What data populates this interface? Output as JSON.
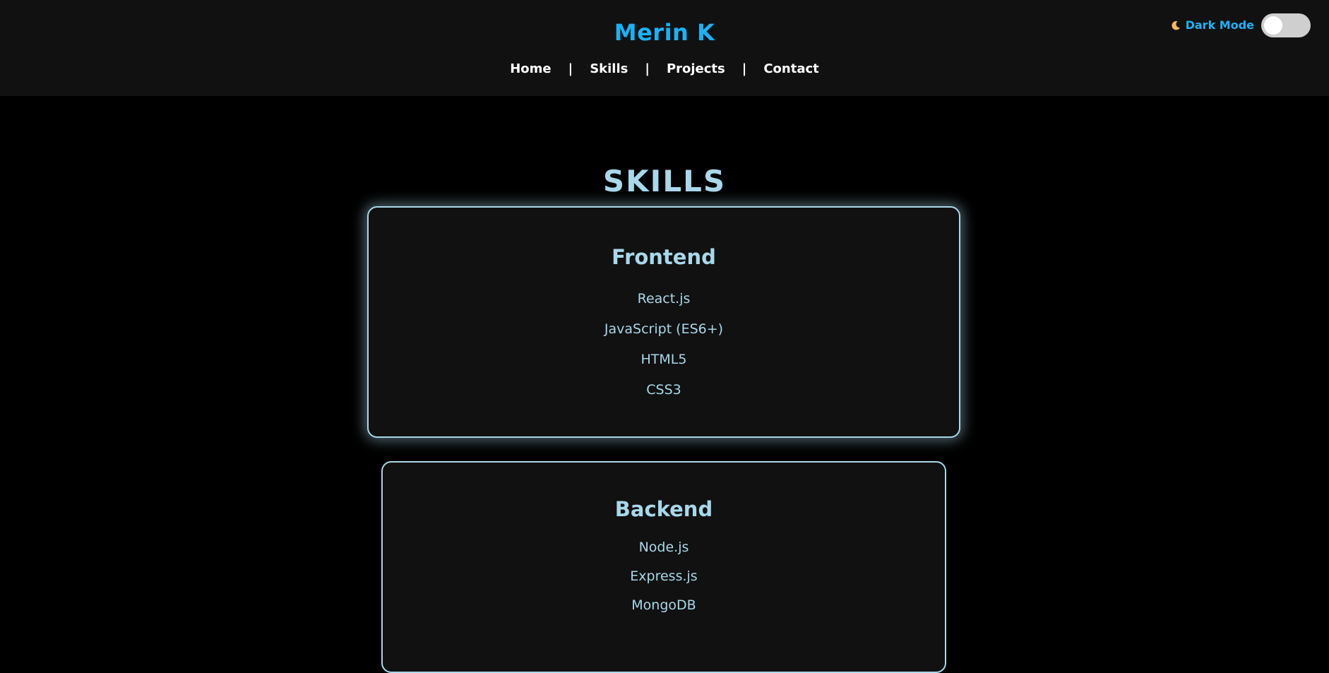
{
  "header": {
    "brand": "Merin K",
    "nav": [
      {
        "label": "Home"
      },
      {
        "label": "Skills"
      },
      {
        "label": "Projects"
      },
      {
        "label": "Contact"
      }
    ],
    "separator": "|",
    "theme_toggle": {
      "icon": "moon-icon",
      "label": "Dark Mode",
      "checked": false
    }
  },
  "main": {
    "title": "SKILLS",
    "cards": [
      {
        "title": "Frontend",
        "items": [
          "React.js",
          "JavaScript (ES6+)",
          "HTML5",
          "CSS3"
        ]
      },
      {
        "title": "Backend",
        "items": [
          "Node.js",
          "Express.js",
          "MongoDB"
        ]
      }
    ]
  },
  "colors": {
    "accent": "#1ab2f5",
    "card_text": "#a8d8ea",
    "header_bg": "#111111",
    "page_bg": "#000000"
  }
}
